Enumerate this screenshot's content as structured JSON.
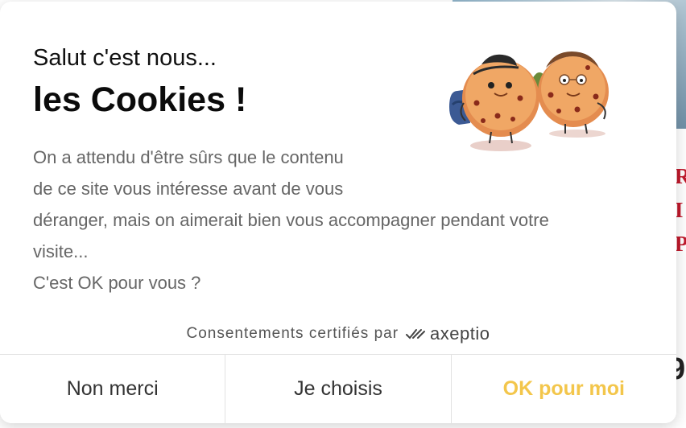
{
  "background": {
    "letters": [
      "R",
      "I",
      "P"
    ],
    "number": "9"
  },
  "modal": {
    "subtitle": "Salut c'est nous...",
    "title": "les Cookies !",
    "body_lines": [
      "On a attendu d'être sûrs que le contenu",
      "de ce site vous intéresse avant de vous",
      "déranger, mais on aimerait bien vous accompagner pendant votre",
      "visite...",
      "C'est OK pour vous ?"
    ],
    "illustration_icon": "cookie-characters-icon",
    "certified_text": "Consentements certifiés par",
    "brand_name": "axeptio",
    "buttons": {
      "decline": "Non merci",
      "choose": "Je choisis",
      "accept": "OK pour moi"
    },
    "colors": {
      "accept": "#f3c64b",
      "text_muted": "#666666",
      "background_accent": "#c0192c"
    }
  }
}
